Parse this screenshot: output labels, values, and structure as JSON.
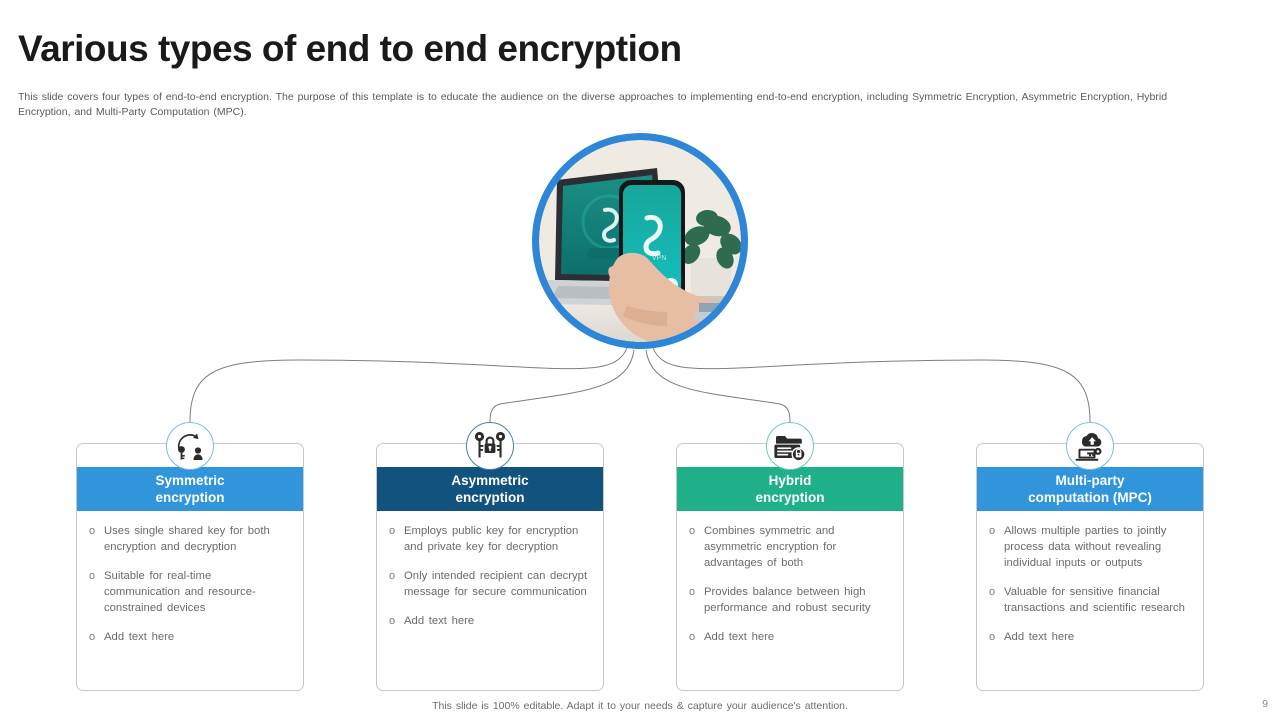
{
  "slide": {
    "title": "Various types of end to end encryption",
    "subtitle": "This slide covers four types of end-to-end encryption. The purpose of this template is to educate the audience on the diverse approaches to implementing end-to-end encryption, including Symmetric Encryption, Asymmetric Encryption, Hybrid Encryption,  and Multi-Party Computation (MPC).",
    "footer_note": "This slide is 100% editable. Adapt it to your needs & capture your audience's attention.",
    "page_number": "9"
  },
  "hero": {
    "icon": "hand-holding-phone-vpn-photo",
    "ring_color": "#2e86d8"
  },
  "colors": {
    "blue": "#3095db",
    "navy": "#12527f",
    "green": "#1fb089",
    "bullet_text": "#6b6b6b",
    "title": "#1a1a1a"
  },
  "cards": [
    {
      "id": "symmetric-encryption",
      "title_line1": "Symmetric",
      "title_line2": "encryption",
      "header_color": "#3095db",
      "ring_color": "#7fb8e4",
      "icon": "key-arrow-lock-icon",
      "bullets": [
        "Uses single shared key for both encryption and decryption",
        "Suitable for real-time communication and resource-constrained devices",
        "Add text here"
      ]
    },
    {
      "id": "asymmetric-encryption",
      "title_line1": "Asymmetric",
      "title_line2": "encryption",
      "header_color": "#12527f",
      "ring_color": "#4a7fae",
      "icon": "two-keys-padlock-icon",
      "bullets": [
        "Employs public key for encryption and private  key for decryption",
        "Only intended recipient can decrypt message for secure communication",
        "Add text here"
      ]
    },
    {
      "id": "hybrid-encryption",
      "title_line1": "Hybrid",
      "title_line2": "encryption",
      "header_color": "#1fb089",
      "ring_color": "#6fcbae",
      "icon": "server-folder-lock-icon",
      "bullets": [
        "Combines symmetric and asymmetric encryption for advantages  of both",
        "Provides balance between high performance  and robust security",
        "Add text here"
      ]
    },
    {
      "id": "multi-party-computation",
      "title_line1": "Multi-party",
      "title_line2": "computation (MPC)",
      "header_color": "#3095db",
      "ring_color": "#7fb8e4",
      "icon": "cloud-laptop-key-icon",
      "bullets": [
        "Allows multiple parties to jointly process data without revealing individual inputs or outputs",
        "Valuable for sensitive financial transactions and scientific research",
        "Add text here"
      ]
    }
  ],
  "bullet_marker": "o"
}
